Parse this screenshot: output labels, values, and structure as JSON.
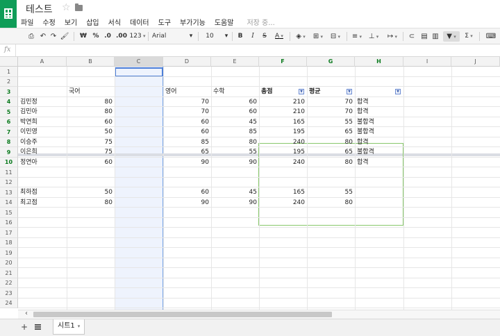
{
  "app": {
    "title": "테스트",
    "saving_status": "저장 중..."
  },
  "menu": [
    "파일",
    "수정",
    "보기",
    "삽입",
    "서식",
    "데이터",
    "도구",
    "부가기능",
    "도움말"
  ],
  "toolbar": {
    "currency": "₩",
    "percent": "%",
    "dec_decrease": ".0",
    "dec_increase": ".00",
    "more_formats": "123",
    "font": "Arial",
    "font_size": "10",
    "bold": "B",
    "italic": "I",
    "strike": "S",
    "text_color": "A",
    "functions": "Σ"
  },
  "formula_bar": {
    "fx_label": "fx",
    "value": ""
  },
  "columns": [
    "A",
    "B",
    "C",
    "D",
    "E",
    "F",
    "G",
    "H",
    "I",
    "J"
  ],
  "selected_column": "C",
  "rows": [
    "1",
    "2",
    "3",
    "4",
    "5",
    "6",
    "7",
    "8",
    "9",
    "10",
    "11",
    "12",
    "13",
    "14",
    "15",
    "16",
    "17",
    "18",
    "19",
    "20",
    "21",
    "22",
    "23",
    "24"
  ],
  "headers": {
    "b": "국어",
    "d": "영어",
    "e": "수학",
    "f": "총점",
    "g": "평균"
  },
  "students": [
    {
      "name": "김민정",
      "kor": "80",
      "eng": "70",
      "math": "60",
      "total": "210",
      "avg": "70",
      "result": "합격"
    },
    {
      "name": "김민아",
      "kor": "80",
      "eng": "70",
      "math": "60",
      "total": "210",
      "avg": "70",
      "result": "합격"
    },
    {
      "name": "박연희",
      "kor": "60",
      "eng": "60",
      "math": "45",
      "total": "165",
      "avg": "55",
      "result": "불합격"
    },
    {
      "name": "이민영",
      "kor": "50",
      "eng": "60",
      "math": "85",
      "total": "195",
      "avg": "65",
      "result": "불합격"
    },
    {
      "name": "이승주",
      "kor": "75",
      "eng": "85",
      "math": "80",
      "total": "240",
      "avg": "80",
      "result": "합격"
    },
    {
      "name": "이은희",
      "kor": "75",
      "eng": "65",
      "math": "55",
      "total": "195",
      "avg": "65",
      "result": "불합격"
    },
    {
      "name": "정연아",
      "kor": "60",
      "eng": "90",
      "math": "90",
      "total": "240",
      "avg": "80",
      "result": "합격"
    }
  ],
  "stats": [
    {
      "label": "최하점",
      "kor": "50",
      "eng": "60",
      "math": "45",
      "total": "165",
      "avg": "55"
    },
    {
      "label": "최고점",
      "kor": "80",
      "eng": "90",
      "math": "90",
      "total": "240",
      "avg": "80"
    }
  ],
  "sheet_tabs": [
    {
      "name": "시트1",
      "active": true
    }
  ],
  "colors": {
    "logo": "#0f9d58",
    "selection": "#eef3fd",
    "selection_border": "#4d7fd8",
    "filter_border": "#87c76a"
  }
}
